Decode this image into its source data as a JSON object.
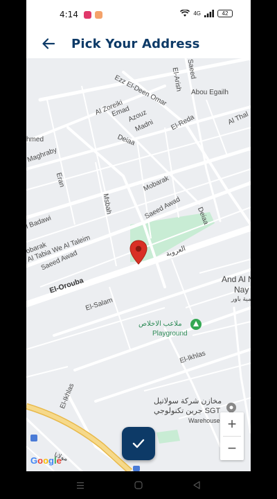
{
  "status_bar": {
    "time": "4:14",
    "battery": "42",
    "network": "4G",
    "network_sub": "ull"
  },
  "app_bar": {
    "title": "Pick Your Address"
  },
  "map": {
    "streets": [
      {
        "key": "ezz",
        "text": "Ezz El-Deen Omar"
      },
      {
        "key": "arish",
        "text": "El-Arish"
      },
      {
        "key": "saeed_top",
        "text": "Saeed"
      },
      {
        "key": "abou",
        "text": "Abou Egailh"
      },
      {
        "key": "zoreiki",
        "text": "Al Zoreiki"
      },
      {
        "key": "emad",
        "text": "Emad"
      },
      {
        "key": "azouz",
        "text": "Azouz"
      },
      {
        "key": "madni",
        "text": "Madni"
      },
      {
        "key": "reda",
        "text": "El-Reda"
      },
      {
        "key": "thal",
        "text": "Al Thal"
      },
      {
        "key": "hmed",
        "text": "hmed"
      },
      {
        "key": "deiaa_top",
        "text": "Deiaa"
      },
      {
        "key": "maghraby",
        "text": "Maghraby"
      },
      {
        "key": "eran",
        "text": "Eran"
      },
      {
        "key": "msbah",
        "text": "Msbah"
      },
      {
        "key": "mobarak_mid",
        "text": "Mobarak"
      },
      {
        "key": "saeed_awad_top",
        "text": "Saeed Awad"
      },
      {
        "key": "deiaa_mid",
        "text": "Deiaa"
      },
      {
        "key": "badawi",
        "text": "l Badawi"
      },
      {
        "key": "obarak",
        "text": "obarak"
      },
      {
        "key": "tabia",
        "text": "Al Tabia We Al Taleim"
      },
      {
        "key": "saeed_awad_bottom",
        "text": "Saeed Awad"
      },
      {
        "key": "orouba",
        "text": "El-Orouba"
      },
      {
        "key": "orouba_ar",
        "text": "العروبة"
      },
      {
        "key": "salam",
        "text": "El-Salam"
      },
      {
        "key": "ikhlas",
        "text": "El-Ikhlas"
      },
      {
        "key": "ikhlas2",
        "text": "El-Ikhlas"
      }
    ],
    "places": {
      "and_al": "And Al N",
      "nay": "Nay",
      "nay_ar": "لمية باور",
      "playground_ar": "ملاعب الاخلاص",
      "playground": "Playground",
      "sgt_ar_1": "مخازن شركة سولاتيل",
      "sgt_ar_2": "جرين تكنولوجي SGT",
      "warehouse": "Warehouse",
      "bottom_ar": "مولانا"
    },
    "attribution": "Google",
    "zoom_in": "+",
    "zoom_out": "−"
  },
  "icons": {
    "back": "arrow-left-icon",
    "pin": "map-pin-icon",
    "confirm": "check-icon",
    "playground": "tree-icon"
  },
  "colors": {
    "primary": "#0d3a67",
    "pin": "#d93025",
    "park": "#c8ecd4",
    "highway": "#f3d27a"
  }
}
